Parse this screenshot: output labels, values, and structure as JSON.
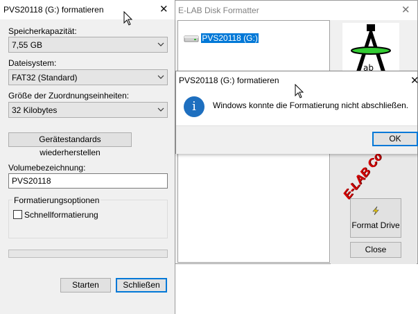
{
  "format_dialog": {
    "title": "PVS20118 (G:) formatieren",
    "capacity_label": "Speicherkapazität:",
    "capacity_value": "7,55 GB",
    "filesystem_label": "Dateisystem:",
    "filesystem_value": "FAT32 (Standard)",
    "allocation_label": "Größe der Zuordnungseinheiten:",
    "allocation_value": "32 Kilobytes",
    "restore_defaults_label": "Gerätestandards wiederherstellen",
    "volume_label_caption": "Volumebezeichnung:",
    "volume_label_value": "PVS20118",
    "options_group_label": "Formatierungsoptionen",
    "quick_format_label": "Schnellformatierung",
    "quick_format_checked": false,
    "progress": 0,
    "start_label": "Starten",
    "close_label": "Schließen"
  },
  "elab": {
    "title": "E-LAB Disk Formatter",
    "drive_item": "PVS20118 (G:)",
    "brand_text": "E-LAB Co",
    "format_drive_label": "Format Drive",
    "close_label": "Close"
  },
  "message_box": {
    "title": "PVS20118 (G:) formatieren",
    "icon": "info-icon",
    "text": "Windows konnte die Formatierung nicht abschließen.",
    "ok_label": "OK"
  },
  "colors": {
    "accent": "#0078d7",
    "info_icon": "#1e6fbf",
    "elab_red": "#d40000"
  }
}
